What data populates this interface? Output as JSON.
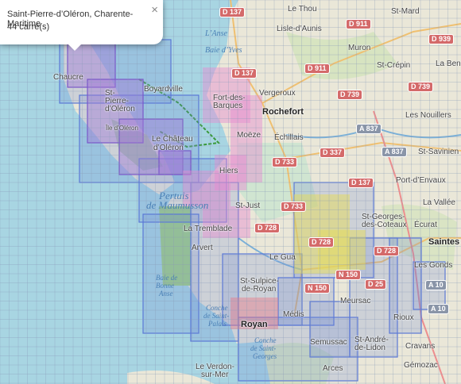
{
  "popup": {
    "title": "Saint-Pierre-d’Oléron, Charente-Maritime",
    "count": "44 carré(s)",
    "close_glyph": "×"
  },
  "places": {
    "le_thou": "Le Thou",
    "st_mard": "St-Mard",
    "lile_daunis": "Lisle-d’Aunis",
    "muron": "Muron",
    "st_crepin": "St-Crépin",
    "la_benate": "La Bena",
    "chaucre": "Chaucre",
    "boyardville": "Boyardville",
    "st_pierre_1": "St-",
    "st_pierre_2": "Pierre-",
    "st_pierre_3": "d’Oléron",
    "ile_doleron": "Île d’Oléron",
    "fort_barques_1": "Fort-des-",
    "fort_barques_2": "Barques",
    "vergeroux": "Vergeroux",
    "rochefort": "Rochefort",
    "les_nouillers": "Les Nouillers",
    "chateau_1": "Le Château",
    "chateau_2": "d’Oléron",
    "moeze": "Moëze",
    "echillais": "Échillais",
    "st_savinien": "St-Savinien",
    "hiers": "Hiers",
    "port_denvaux": "Port-d’Envaux",
    "st_just": "St-Just",
    "la_vallee": "La Vallée",
    "la_tremblade": "La Tremblade",
    "arvert": "Arvert",
    "le_gua": "Le Gua",
    "st_georges_1": "St-Georges-",
    "st_georges_2": "des-Coteaux",
    "ecurat": "Écurat",
    "saintes": "Saintes",
    "les_gonds": "Les Gonds",
    "st_sulpice_1": "St-Sulpice-",
    "st_sulpice_2": "de-Royan",
    "meursac": "Meursac",
    "rioux": "Rioux",
    "royan": "Royan",
    "medis": "Médis",
    "semussac": "Semussac",
    "st_andre_1": "St-André-",
    "st_andre_2": "de-Lidon",
    "cravans": "Cravans",
    "arces": "Arces",
    "gemozac": "Gémozac",
    "le_verdon_1": "Le Verdon-",
    "le_verdon_2": "sur-Mer"
  },
  "waters": {
    "lanse": "L’Anse",
    "baie_yves": "Baie d’Yves",
    "pertuis_1": "Pertuis",
    "pertuis_2": "de Maumusson",
    "bonne_1": "Baie de",
    "bonne_2": "Bonne",
    "bonne_3": "Anse",
    "conche_1": "Conche",
    "conche_2": "de Saint-",
    "conche_3": "Palais",
    "conche_4": "Conche",
    "conche_5": "de Saint-",
    "conche_6": "Georges"
  },
  "roads": {
    "d137_top": "D 137",
    "d911a": "D 911",
    "d939": "D 939",
    "d911b": "D 911",
    "d739a": "D 739",
    "d739b": "D 739",
    "d137b": "D 137",
    "d733a": "D 733",
    "a837a": "A 837",
    "d337": "D 337",
    "a837b": "A 837",
    "d137c": "D 137",
    "d733b": "D 733",
    "d728a": "D 728",
    "d728b": "D 728",
    "d728c": "D 728",
    "n150a": "N 150",
    "n150b": "N 150",
    "a10a": "A 10",
    "a10b": "A 10",
    "d25": "D 25"
  },
  "colors": {
    "sea": "#a8d5e2",
    "land": "#eae7d8",
    "forest": "#b8d8a0",
    "marsh": "#c9e5d0",
    "cell_blue": "#6a86d8",
    "cell_purple": "#a27ad6",
    "cell_pink": "#e68ad0",
    "cell_yellow": "#e6dc5a",
    "cell_red": "#e87a8a"
  }
}
